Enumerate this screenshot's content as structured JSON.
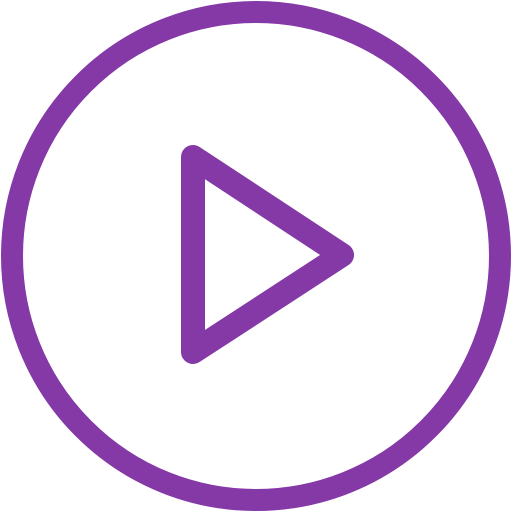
{
  "icon": {
    "name": "play-circle-icon",
    "color": "#8439A7",
    "background": "#FFFFFF"
  }
}
